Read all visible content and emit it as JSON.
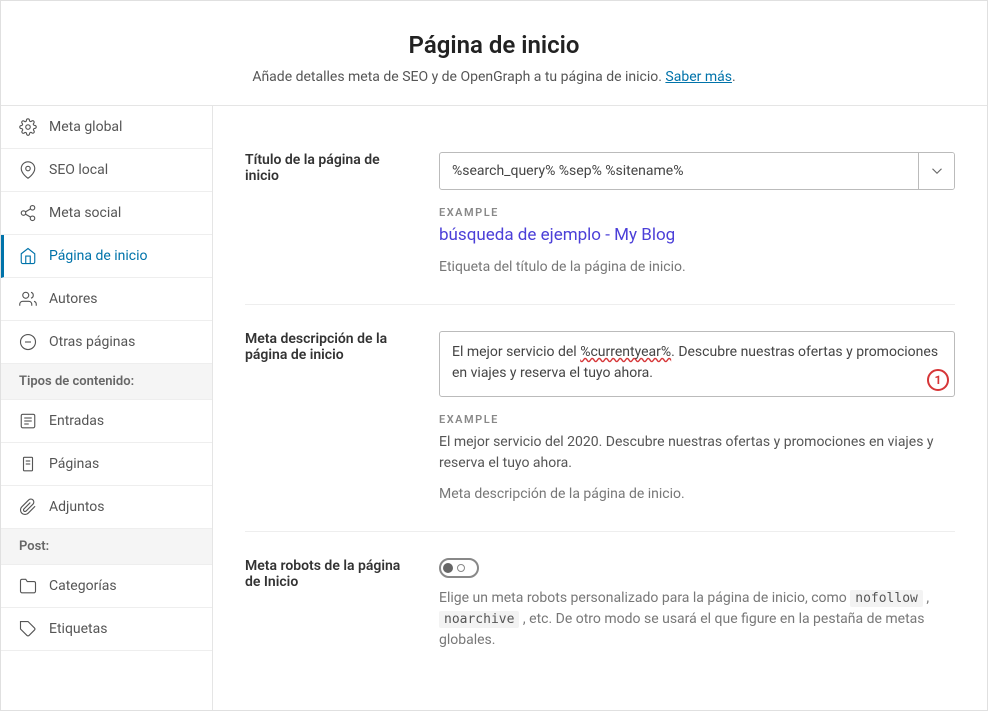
{
  "header": {
    "title": "Página de inicio",
    "subtitle_prefix": "Añade detalles meta de SEO y de OpenGraph a tu página de inicio. ",
    "learn_more": "Saber más",
    "subtitle_suffix": "."
  },
  "sidebar": {
    "items_main": [
      {
        "id": "meta-global",
        "label": "Meta global",
        "icon": "gear"
      },
      {
        "id": "seo-local",
        "label": "SEO local",
        "icon": "pin"
      },
      {
        "id": "meta-social",
        "label": "Meta social",
        "icon": "share"
      },
      {
        "id": "home",
        "label": "Página de inicio",
        "icon": "home",
        "active": true
      },
      {
        "id": "autores",
        "label": "Autores",
        "icon": "users"
      },
      {
        "id": "otras",
        "label": "Otras páginas",
        "icon": "minus"
      }
    ],
    "group_content_title": "Tipos de contenido:",
    "items_content": [
      {
        "id": "entradas",
        "label": "Entradas",
        "icon": "post"
      },
      {
        "id": "paginas",
        "label": "Páginas",
        "icon": "page"
      },
      {
        "id": "adjuntos",
        "label": "Adjuntos",
        "icon": "clip"
      }
    ],
    "group_post_title": "Post:",
    "items_post": [
      {
        "id": "categorias",
        "label": "Categorías",
        "icon": "folder"
      },
      {
        "id": "etiquetas",
        "label": "Etiquetas",
        "icon": "tag"
      }
    ]
  },
  "settings": {
    "title_row": {
      "label": "Título de la página de inicio",
      "value": "%search_query% %sep% %sitename%",
      "example_label": "EXAMPLE",
      "example_value": "búsqueda de ejemplo - My Blog",
      "help": "Etiqueta del título de la página de inicio."
    },
    "desc_row": {
      "label": "Meta descripción de la página de inicio",
      "value_prefix": "El mejor servicio del ",
      "value_token": "%currentyear%",
      "value_suffix": ". Descubre nuestras ofertas y promociones en viajes y reserva el tuyo ahora.",
      "badge": "1",
      "example_label": "EXAMPLE",
      "example_value": "El mejor servicio del 2020. Descubre nuestras ofertas y promociones en viajes y reserva el tuyo ahora.",
      "help": "Meta descripción de la página de inicio."
    },
    "robots_row": {
      "label": "Meta robots de la página de Inicio",
      "help_prefix": "Elige un meta robots personalizado para la página de inicio, como ",
      "code1": "nofollow",
      "help_mid": " , ",
      "code2": "noarchive",
      "help_suffix": " , etc. De otro modo se usará el que figure en la pestaña de metas globales."
    }
  }
}
